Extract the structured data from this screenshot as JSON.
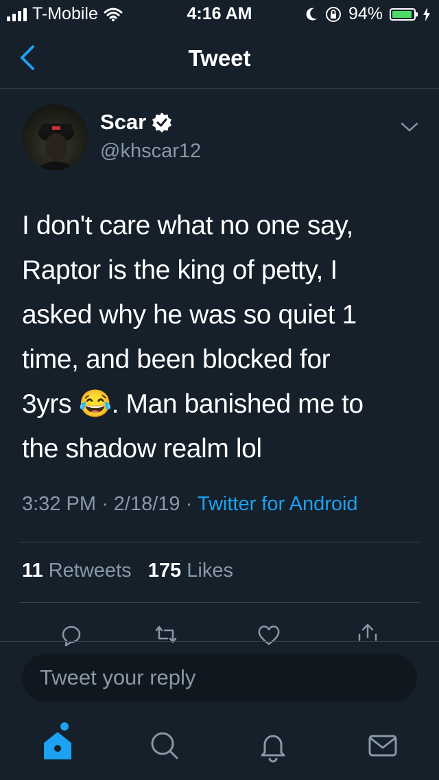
{
  "status_bar": {
    "carrier": "T-Mobile",
    "time": "4:16 AM",
    "battery_percent": "94%",
    "battery_level": 0.94
  },
  "nav": {
    "title": "Tweet"
  },
  "tweet": {
    "author_name": "Scar",
    "author_handle": "@khscar12",
    "text_lines": [
      "I don't care what no one say,",
      "Raptor is the king of petty, I",
      "asked why he was so quiet 1",
      "time, and been blocked for",
      "3yrs 😂. Man banished me to",
      "the shadow realm lol"
    ],
    "time": "3:32 PM",
    "date": "2/18/19",
    "separator": "·",
    "source": "Twitter for Android",
    "retweets_count": "11",
    "retweets_label": "Retweets",
    "likes_count": "175",
    "likes_label": "Likes"
  },
  "reply": {
    "placeholder": "Tweet your reply"
  },
  "colors": {
    "background": "#15202b",
    "accent": "#1da1f2",
    "secondary_text": "#8899a6",
    "divider": "#38444d"
  }
}
